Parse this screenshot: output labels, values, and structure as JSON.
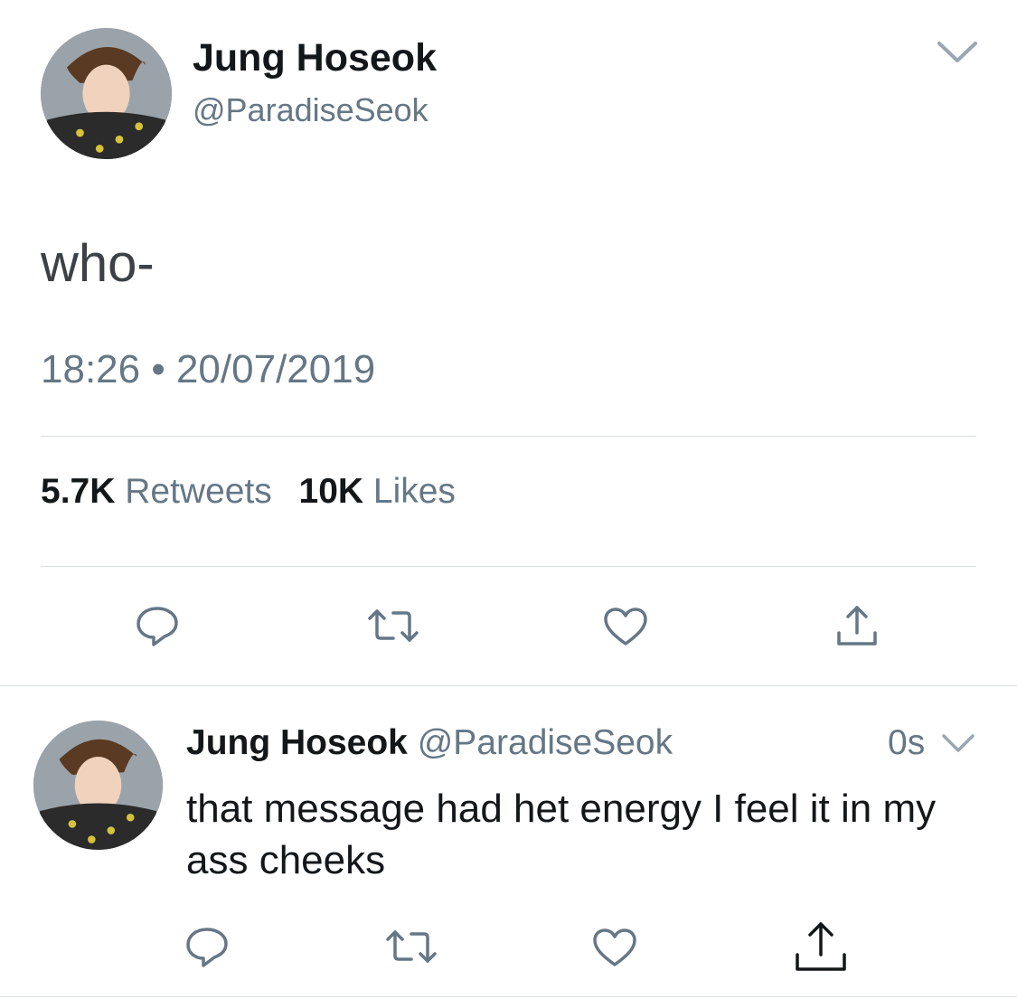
{
  "main_tweet": {
    "author_name": "Jung Hoseok",
    "handle": "@ParadiseSeok",
    "text": "who-",
    "timestamp": "18:26 • 20/07/2019",
    "retweets_count": "5.7K",
    "retweets_label": "Retweets",
    "likes_count": "10K",
    "likes_label": "Likes",
    "menu_icon": "chevron-down-icon"
  },
  "reply_tweet": {
    "author_name": "Jung Hoseok",
    "handle": "@ParadiseSeok",
    "time_ago": "0s",
    "text": "that message had het energy I feel it in my ass cheeks",
    "menu_icon": "chevron-down-icon"
  },
  "actions": [
    "reply-icon",
    "retweet-icon",
    "like-icon",
    "share-icon"
  ],
  "colors": {
    "text": "#14171a",
    "muted": "#657786",
    "divider": "#d9dee2"
  }
}
